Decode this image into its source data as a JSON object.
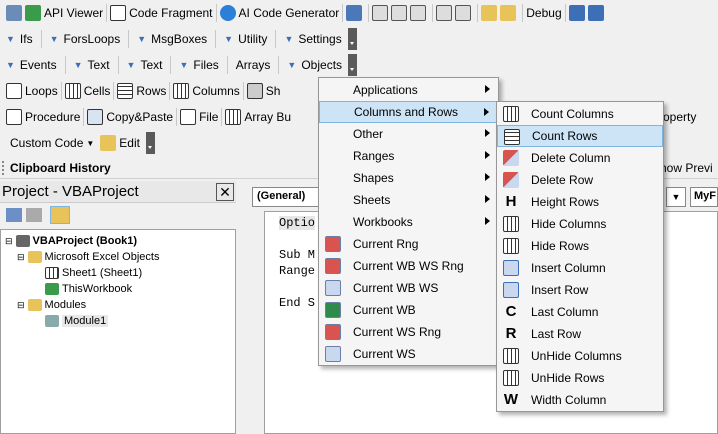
{
  "toolbar1": {
    "api_viewer": "API Viewer",
    "code_fragment": "Code Fragment",
    "ai_code_generator": "AI Code Generator",
    "debug": "Debug"
  },
  "toolbar2": [
    "Ifs",
    "ForsLoops",
    "MsgBoxes",
    "Utility",
    "Settings"
  ],
  "toolbar3": [
    "Events",
    "Text",
    "Text",
    "Files",
    "Arrays",
    "Objects"
  ],
  "toolbar4": [
    "Loops",
    "Cells",
    "Rows",
    "Columns",
    "Sh"
  ],
  "toolbar5": [
    "Procedure",
    "Copy&Paste",
    "File",
    "Array Bu"
  ],
  "toolbar6": {
    "custom_code": "Custom Code",
    "edit": "Edit"
  },
  "clipboard_history": "Clipboard History",
  "show_preview": "how Previ",
  "right_toolbar_fragment": "roperty",
  "project": {
    "title": "Project - VBAProject",
    "root": "VBAProject (Book1)",
    "folder1": "Microsoft Excel Objects",
    "sheet1": "Sheet1 (Sheet1)",
    "thisworkbook": "ThisWorkbook",
    "folder2": "Modules",
    "module1": "Module1"
  },
  "code": {
    "general": "(General)",
    "right_dropdown": "MyF",
    "lines": [
      "Optio",
      "Sub M",
      "Range",
      "End S"
    ]
  },
  "objects_menu": [
    {
      "label": "Applications",
      "sub": true,
      "icon": "none"
    },
    {
      "label": "Columns and Rows",
      "sub": true,
      "icon": "none",
      "highlight": true
    },
    {
      "label": "Other",
      "sub": true,
      "icon": "none"
    },
    {
      "label": "Ranges",
      "sub": true,
      "icon": "none"
    },
    {
      "label": "Shapes",
      "sub": true,
      "icon": "none"
    },
    {
      "label": "Sheets",
      "sub": true,
      "icon": "none"
    },
    {
      "label": "Workbooks",
      "sub": true,
      "icon": "none"
    },
    {
      "label": "Current Rng",
      "sub": false,
      "icon": "range-icon"
    },
    {
      "label": "Current WB WS Rng",
      "sub": false,
      "icon": "range-icon"
    },
    {
      "label": "Current WB WS",
      "sub": false,
      "icon": "sheet-icon"
    },
    {
      "label": "Current WB",
      "sub": false,
      "icon": "excel-icon"
    },
    {
      "label": "Current WS Rng",
      "sub": false,
      "icon": "range-icon"
    },
    {
      "label": "Current WS",
      "sub": false,
      "icon": "sheet-icon"
    }
  ],
  "columns_rows_menu": [
    {
      "label": "Count Columns",
      "icon": "grid"
    },
    {
      "label": "Count Rows",
      "icon": "rows",
      "highlight": true
    },
    {
      "label": "Delete Column",
      "icon": "delcol"
    },
    {
      "label": "Delete Row",
      "icon": "delrow"
    },
    {
      "label": "Height Rows",
      "icon": "H"
    },
    {
      "label": "Hide Columns",
      "icon": "grid"
    },
    {
      "label": "Hide Rows",
      "icon": "grid"
    },
    {
      "label": "Insert Column",
      "icon": "inscol"
    },
    {
      "label": "Insert Row",
      "icon": "insrow"
    },
    {
      "label": "Last Column",
      "icon": "C"
    },
    {
      "label": "Last Row",
      "icon": "R"
    },
    {
      "label": "UnHide Columns",
      "icon": "grid"
    },
    {
      "label": "UnHide Rows",
      "icon": "grid"
    },
    {
      "label": "Width Column",
      "icon": "W"
    }
  ],
  "colors": {
    "highlight_bg": "#cde4f7",
    "highlight_border": "#7fb6e0",
    "accent_blue": "#3c6fb5"
  }
}
